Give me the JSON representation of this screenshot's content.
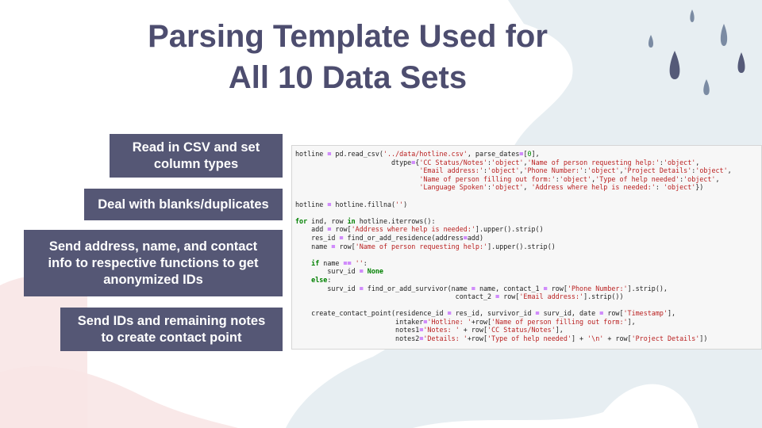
{
  "title": {
    "line1": "Parsing Template Used for",
    "line2": "All 10 Data Sets"
  },
  "steps": [
    {
      "line1": "Read in CSV and set",
      "line2": "column types"
    },
    {
      "line1": "Deal with blanks/duplicates"
    },
    {
      "line1": "Send address, name, and contact",
      "line2": "info to respective functions to get",
      "line3": "anonymized IDs"
    },
    {
      "line1": "Send IDs and remaining notes",
      "line2": "to create contact point"
    }
  ],
  "code_lines": [
    "hotline = pd.read_csv('../data/hotline.csv', parse_dates=[0],",
    "                        dtype={'CC Status/Notes':'object','Name of person requesting help:':'object',",
    "                               'Email address:':'object','Phone Number:':'object','Project Details':'object',",
    "                               'Name of person filling out form:':'object','Type of help needed':'object',",
    "                               'Language Spoken':'object', 'Address where help is needed:': 'object'})",
    "",
    "hotline = hotline.fillna('')",
    "",
    "for ind, row in hotline.iterrows():",
    "    add = row['Address where help is needed:'].upper().strip()",
    "    res_id = find_or_add_residence(address=add)",
    "    name = row['Name of person requesting help:'].upper().strip()",
    "",
    "    if name == '':",
    "        surv_id = None",
    "    else:",
    "        surv_id = find_or_add_survivor(name = name, contact_1 = row['Phone Number:'].strip(),",
    "                                        contact_2 = row['Email address:'].strip())",
    "",
    "    create_contact_point(residence_id = res_id, survivor_id = surv_id, date = row['Timestamp'],",
    "                         intaker='Hotline: '+row['Name of person filling out form:'],",
    "                         notes1='Notes: ' + row['CC Status/Notes'],",
    "                         notes2='Details: '+row['Type of help needed'] + '\\n' + row['Project Details'])"
  ],
  "colors": {
    "title": "#4d4d6f",
    "box": "#555775",
    "drops": "#555a78",
    "splash_blue": "#e4ecf1",
    "splash_pink": "#f8e6e6"
  }
}
